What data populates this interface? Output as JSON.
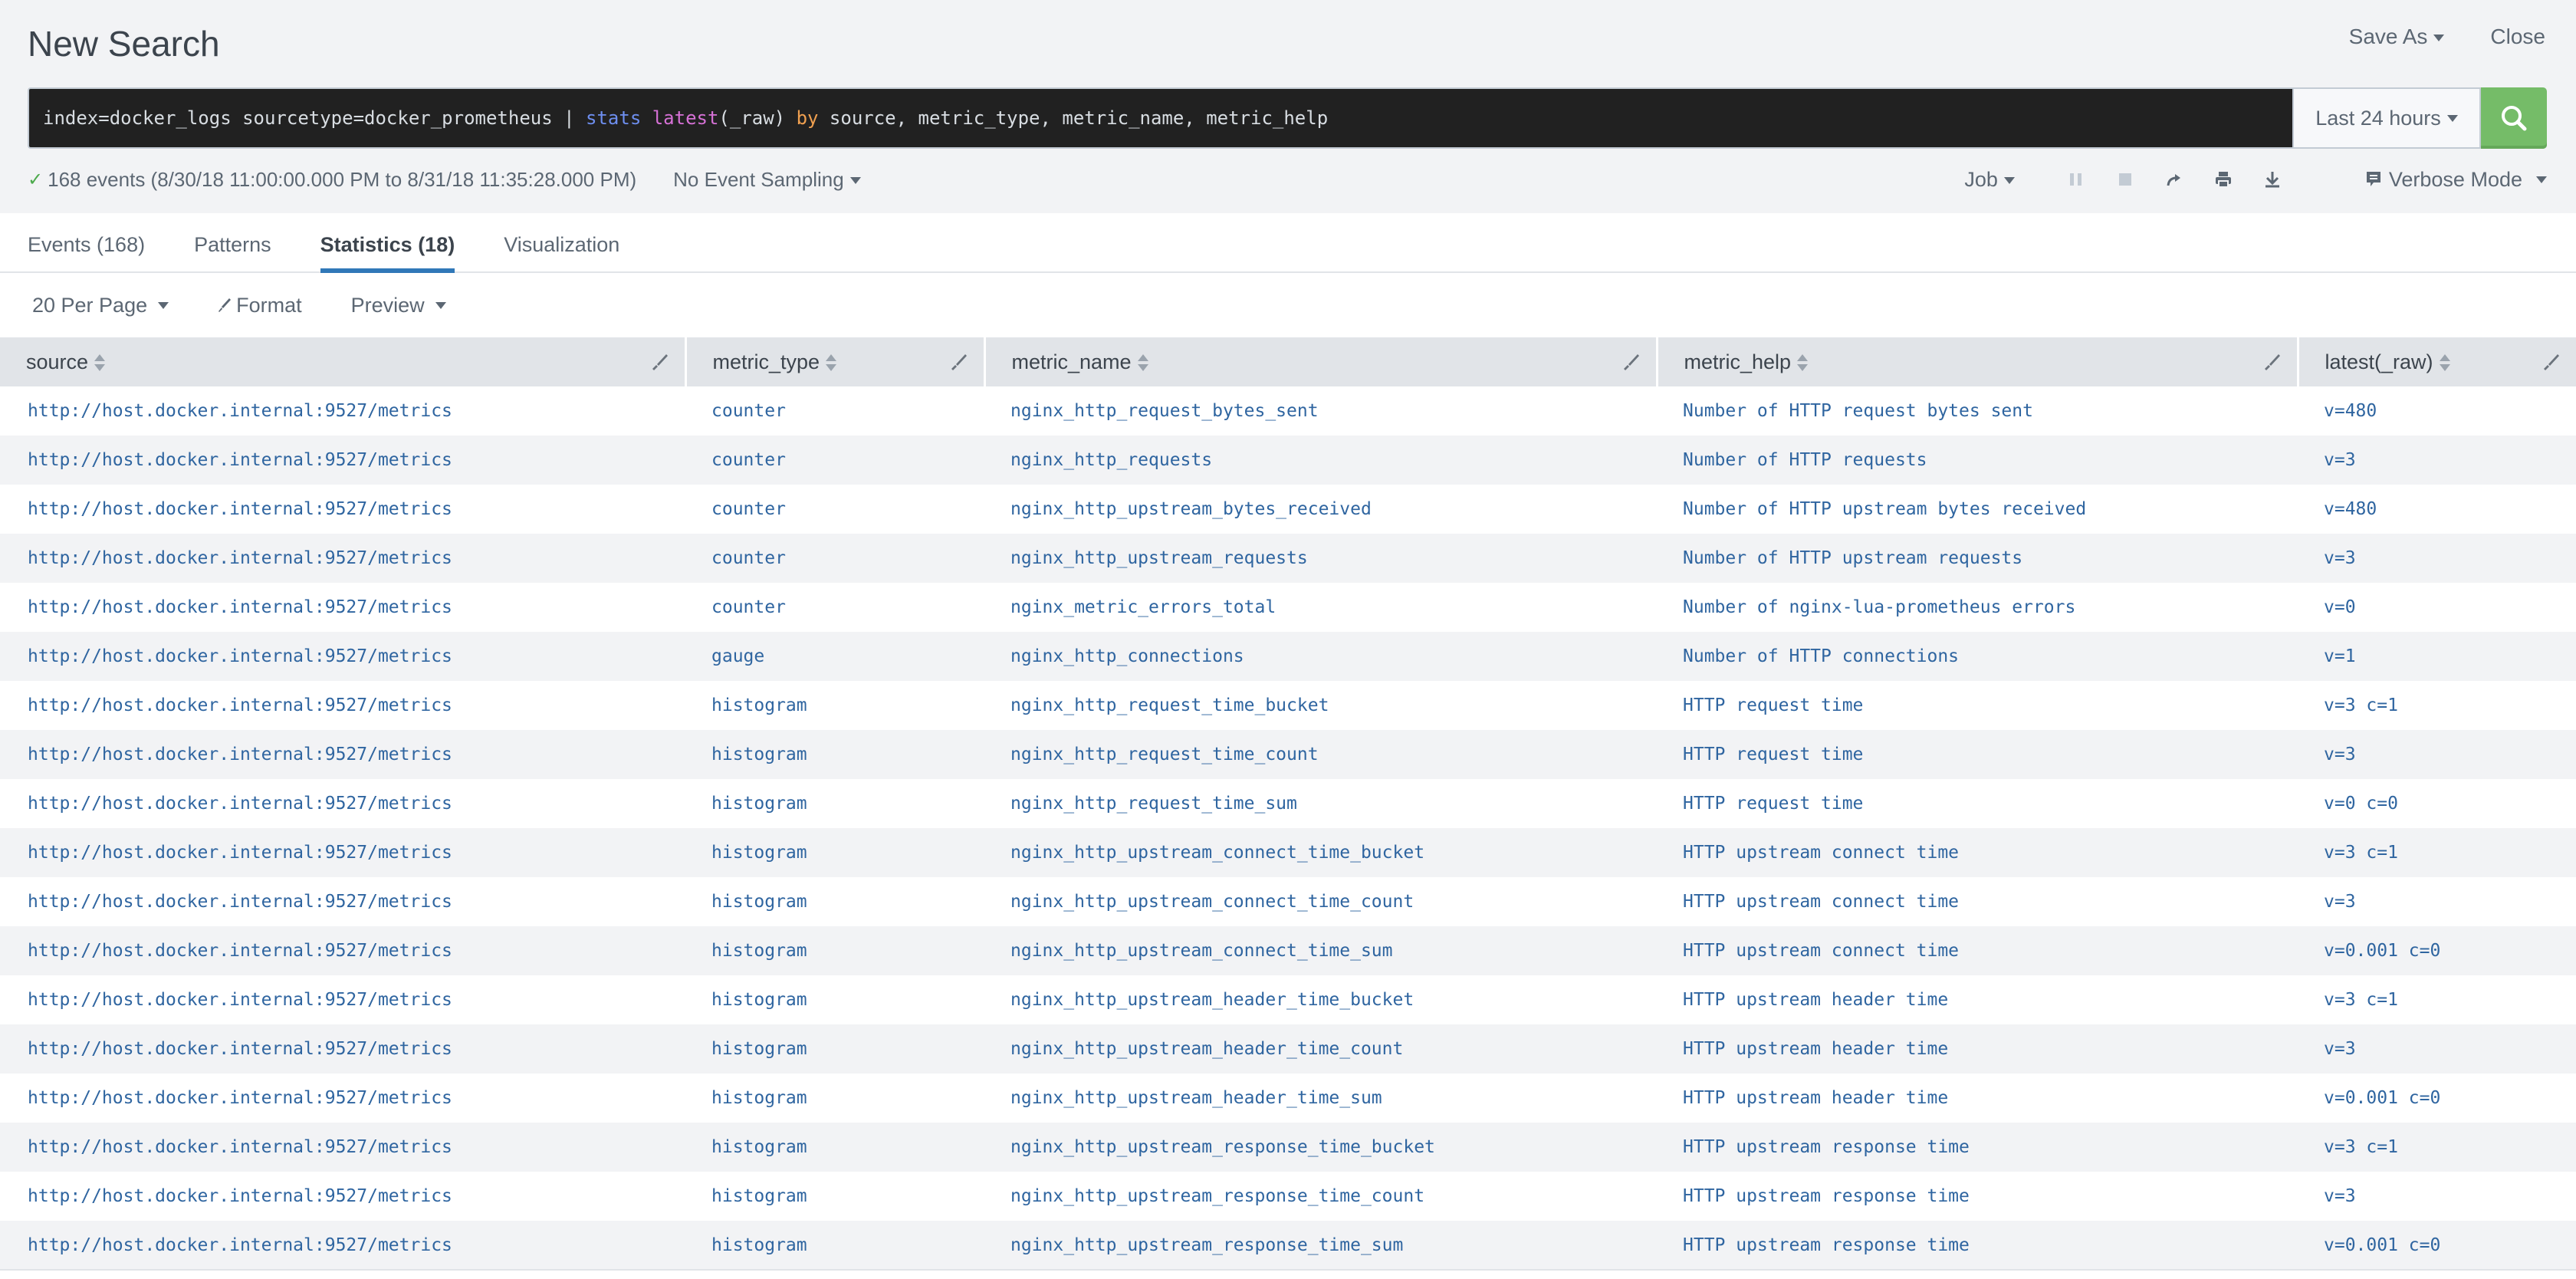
{
  "header": {
    "title": "New Search",
    "save_as": "Save As",
    "close": "Close"
  },
  "search": {
    "query_plain_1": "index=docker_logs sourcetype=docker_prometheus | ",
    "query_cmd": "stats",
    "query_space": " ",
    "query_fn": "latest",
    "query_mid": "(_raw) ",
    "query_by": "by",
    "query_rest": " source, metric_type, metric_name, metric_help",
    "time_range": "Last 24 hours",
    "search_icon": "search-icon"
  },
  "status": {
    "check_icon": "✓",
    "summary": "168 events (8/30/18 11:00:00.000 PM to 8/31/18 11:35:28.000 PM)",
    "sampling": "No Event Sampling",
    "job": "Job",
    "mode": "Verbose Mode"
  },
  "tabs": [
    {
      "label": "Events (168)",
      "active": false
    },
    {
      "label": "Patterns",
      "active": false
    },
    {
      "label": "Statistics (18)",
      "active": true
    },
    {
      "label": "Visualization",
      "active": false
    }
  ],
  "toolbar": {
    "per_page": "20 Per Page",
    "format": "Format",
    "preview": "Preview"
  },
  "table": {
    "columns": [
      "source",
      "metric_type",
      "metric_name",
      "metric_help",
      "latest(_raw)"
    ],
    "rows": [
      [
        "http://host.docker.internal:9527/metrics",
        "counter",
        "nginx_http_request_bytes_sent",
        "Number of HTTP request bytes sent",
        "v=480"
      ],
      [
        "http://host.docker.internal:9527/metrics",
        "counter",
        "nginx_http_requests",
        "Number of HTTP requests",
        "v=3"
      ],
      [
        "http://host.docker.internal:9527/metrics",
        "counter",
        "nginx_http_upstream_bytes_received",
        "Number of HTTP upstream bytes received",
        "v=480"
      ],
      [
        "http://host.docker.internal:9527/metrics",
        "counter",
        "nginx_http_upstream_requests",
        "Number of HTTP upstream requests",
        "v=3"
      ],
      [
        "http://host.docker.internal:9527/metrics",
        "counter",
        "nginx_metric_errors_total",
        "Number of nginx-lua-prometheus errors",
        "v=0"
      ],
      [
        "http://host.docker.internal:9527/metrics",
        "gauge",
        "nginx_http_connections",
        "Number of HTTP connections",
        "v=1"
      ],
      [
        "http://host.docker.internal:9527/metrics",
        "histogram",
        "nginx_http_request_time_bucket",
        "HTTP request time",
        "v=3 c=1"
      ],
      [
        "http://host.docker.internal:9527/metrics",
        "histogram",
        "nginx_http_request_time_count",
        "HTTP request time",
        "v=3"
      ],
      [
        "http://host.docker.internal:9527/metrics",
        "histogram",
        "nginx_http_request_time_sum",
        "HTTP request time",
        "v=0 c=0"
      ],
      [
        "http://host.docker.internal:9527/metrics",
        "histogram",
        "nginx_http_upstream_connect_time_bucket",
        "HTTP upstream connect time",
        "v=3 c=1"
      ],
      [
        "http://host.docker.internal:9527/metrics",
        "histogram",
        "nginx_http_upstream_connect_time_count",
        "HTTP upstream connect time",
        "v=3"
      ],
      [
        "http://host.docker.internal:9527/metrics",
        "histogram",
        "nginx_http_upstream_connect_time_sum",
        "HTTP upstream connect time",
        "v=0.001 c=0"
      ],
      [
        "http://host.docker.internal:9527/metrics",
        "histogram",
        "nginx_http_upstream_header_time_bucket",
        "HTTP upstream header time",
        "v=3 c=1"
      ],
      [
        "http://host.docker.internal:9527/metrics",
        "histogram",
        "nginx_http_upstream_header_time_count",
        "HTTP upstream header time",
        "v=3"
      ],
      [
        "http://host.docker.internal:9527/metrics",
        "histogram",
        "nginx_http_upstream_header_time_sum",
        "HTTP upstream header time",
        "v=0.001 c=0"
      ],
      [
        "http://host.docker.internal:9527/metrics",
        "histogram",
        "nginx_http_upstream_response_time_bucket",
        "HTTP upstream response time",
        "v=3 c=1"
      ],
      [
        "http://host.docker.internal:9527/metrics",
        "histogram",
        "nginx_http_upstream_response_time_count",
        "HTTP upstream response time",
        "v=3"
      ],
      [
        "http://host.docker.internal:9527/metrics",
        "histogram",
        "nginx_http_upstream_response_time_sum",
        "HTTP upstream response time",
        "v=0.001 c=0"
      ]
    ]
  },
  "colors": {
    "search_button": "#75bc68",
    "active_tab_underline": "#3078b8",
    "cell_text": "#2f65a0"
  }
}
